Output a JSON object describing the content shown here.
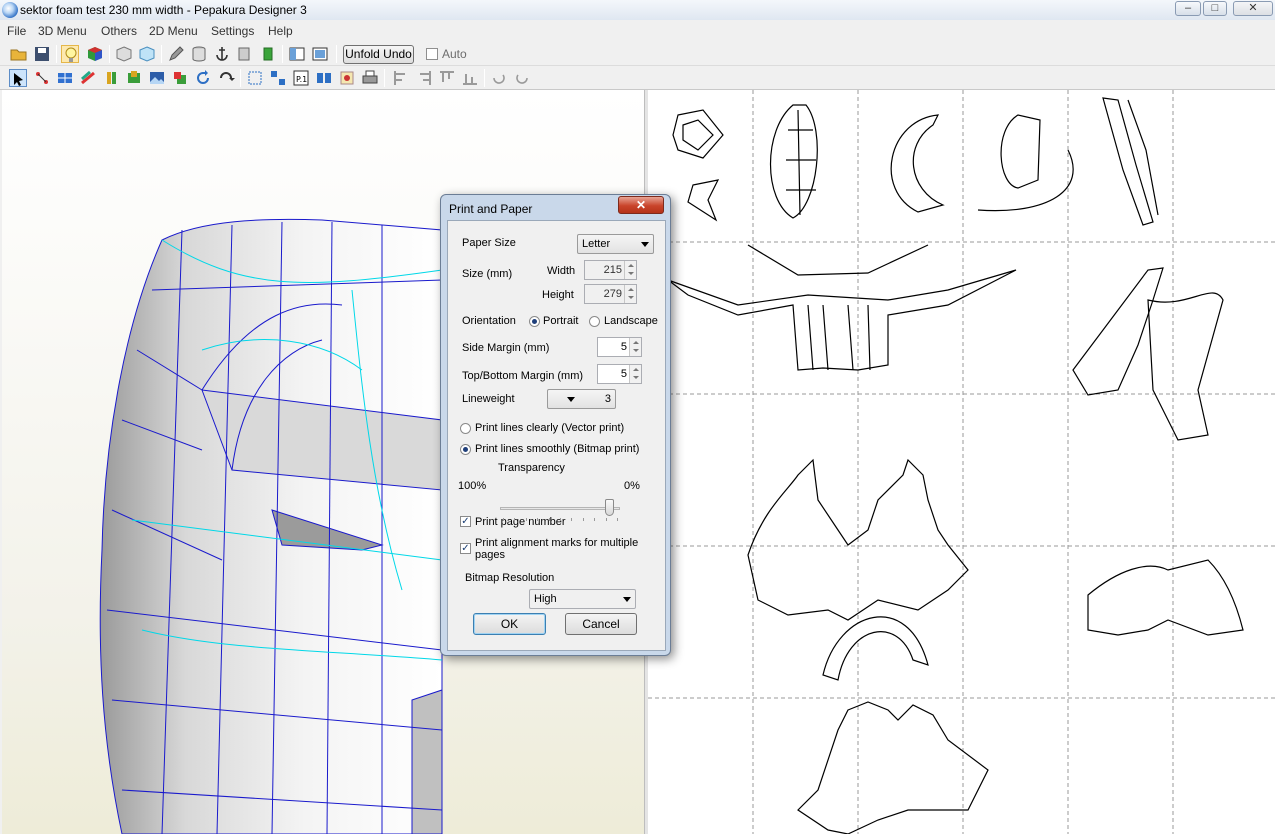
{
  "window": {
    "title": "sektor foam test 230 mm width - Pepakura Designer 3",
    "minimize": "–",
    "maximize": "□",
    "close": "✕"
  },
  "menu": [
    "File",
    "3D Menu",
    "Others",
    "2D Menu",
    "Settings",
    "Help"
  ],
  "toolbar": {
    "unfold_undo": "Unfold Undo",
    "auto_label": "Auto",
    "auto_checked": false,
    "page_icon_label": "P.1"
  },
  "dialog": {
    "title": "Print and Paper",
    "close_label": "✕",
    "paper_size_label": "Paper Size",
    "paper_size_value": "Letter",
    "size_label": "Size (mm)",
    "width_label": "Width",
    "width_value": "215",
    "height_label": "Height",
    "height_value": "279",
    "orientation_label": "Orientation",
    "portrait_label": "Portrait",
    "landscape_label": "Landscape",
    "orientation_selected": "Portrait",
    "side_margin_label": "Side Margin (mm)",
    "side_margin_value": "5",
    "topbottom_margin_label": "Top/Bottom Margin (mm)",
    "topbottom_margin_value": "5",
    "lineweight_label": "Lineweight",
    "lineweight_value": "3",
    "vector_print_label": "Print lines clearly (Vector print)",
    "bitmap_print_label": "Print lines smoothly (Bitmap print)",
    "print_mode_selected": "bitmap",
    "transparency_label": "Transparency",
    "transparency_min_label": "100%",
    "transparency_max_label": "0%",
    "transparency_level": 0.95,
    "page_number_label": "Print page number",
    "page_number_checked": true,
    "alignment_marks_label": "Print alignment marks for multiple pages",
    "alignment_marks_checked": true,
    "bitmap_resolution_label": "Bitmap Resolution",
    "bitmap_resolution_value": "High",
    "ok_label": "OK",
    "cancel_label": "Cancel"
  },
  "colors": {
    "edge_blue": "#1a1acc",
    "fold_cyan": "#00d8e8",
    "dialog_frame": "#c9d8ea"
  }
}
